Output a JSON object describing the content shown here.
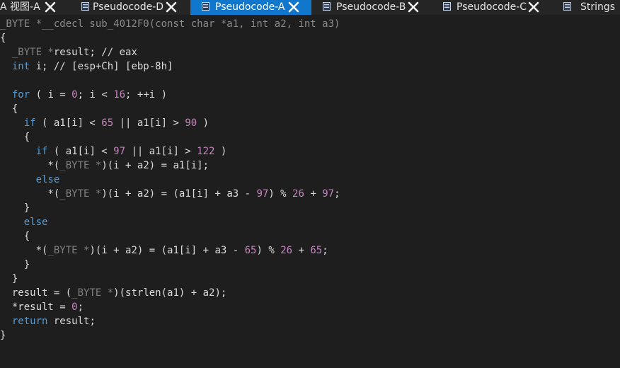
{
  "tabs": [
    {
      "label": "A 视图-A",
      "icon": "",
      "active": false,
      "closable": true
    },
    {
      "label": "Pseudocode-D",
      "icon": "pseudocode-icon",
      "active": false,
      "closable": true
    },
    {
      "label": "Pseudocode-A",
      "icon": "pseudocode-icon",
      "active": true,
      "closable": true
    },
    {
      "label": "Pseudocode-B",
      "icon": "pseudocode-icon",
      "active": false,
      "closable": true
    },
    {
      "label": "Pseudocode-C",
      "icon": "pseudocode-icon",
      "active": false,
      "closable": true
    },
    {
      "label": "Strings",
      "icon": "strings-icon",
      "active": false,
      "closable": false
    }
  ],
  "colors": {
    "background": "#1e1e1e",
    "tabbar": "#252526",
    "active_tab": "#1177cc",
    "keyword": "#569cd6",
    "number": "#c586c0",
    "type": "#7f7f7f",
    "text": "#dcdcdc"
  },
  "code": {
    "lines": [
      [
        [
          "h",
          "_BYTE *__cdecl sub_4012F0(const char *a1, int a2, int a3)"
        ]
      ],
      [
        [
          "p",
          "{"
        ]
      ],
      [
        [
          "p",
          "  "
        ],
        [
          "t",
          "_BYTE *"
        ],
        [
          "p",
          "result; // eax"
        ]
      ],
      [
        [
          "p",
          "  "
        ],
        [
          "k",
          "int"
        ],
        [
          "p",
          " i; // [esp+Ch] [ebp-8h]"
        ]
      ],
      [],
      [
        [
          "p",
          "  "
        ],
        [
          "k",
          "for"
        ],
        [
          "p",
          " ( i = "
        ],
        [
          "n",
          "0"
        ],
        [
          "p",
          "; i < "
        ],
        [
          "n",
          "16"
        ],
        [
          "p",
          "; ++i )"
        ]
      ],
      [
        [
          "p",
          "  {"
        ]
      ],
      [
        [
          "p",
          "    "
        ],
        [
          "k",
          "if"
        ],
        [
          "p",
          " ( a1[i] < "
        ],
        [
          "n",
          "65"
        ],
        [
          "p",
          " || a1[i] > "
        ],
        [
          "n",
          "90"
        ],
        [
          "p",
          " )"
        ]
      ],
      [
        [
          "p",
          "    {"
        ]
      ],
      [
        [
          "p",
          "      "
        ],
        [
          "k",
          "if"
        ],
        [
          "p",
          " ( a1[i] < "
        ],
        [
          "n",
          "97"
        ],
        [
          "p",
          " || a1[i] > "
        ],
        [
          "n",
          "122"
        ],
        [
          "p",
          " )"
        ]
      ],
      [
        [
          "p",
          "        *("
        ],
        [
          "t",
          "_BYTE *"
        ],
        [
          "p",
          ")(i + a2) = a1[i];"
        ]
      ],
      [
        [
          "p",
          "      "
        ],
        [
          "k",
          "else"
        ]
      ],
      [
        [
          "p",
          "        *("
        ],
        [
          "t",
          "_BYTE *"
        ],
        [
          "p",
          ")(i + a2) = (a1[i] + a3 - "
        ],
        [
          "n",
          "97"
        ],
        [
          "p",
          ") % "
        ],
        [
          "n",
          "26"
        ],
        [
          "p",
          " + "
        ],
        [
          "n",
          "97"
        ],
        [
          "p",
          ";"
        ]
      ],
      [
        [
          "p",
          "    }"
        ]
      ],
      [
        [
          "p",
          "    "
        ],
        [
          "k",
          "else"
        ]
      ],
      [
        [
          "p",
          "    {"
        ]
      ],
      [
        [
          "p",
          "      *("
        ],
        [
          "t",
          "_BYTE *"
        ],
        [
          "p",
          ")(i + a2) = (a1[i] + a3 - "
        ],
        [
          "n",
          "65"
        ],
        [
          "p",
          ") % "
        ],
        [
          "n",
          "26"
        ],
        [
          "p",
          " + "
        ],
        [
          "n",
          "65"
        ],
        [
          "p",
          ";"
        ]
      ],
      [
        [
          "p",
          "    }"
        ]
      ],
      [
        [
          "p",
          "  }"
        ]
      ],
      [
        [
          "p",
          "  result = ("
        ],
        [
          "t",
          "_BYTE *"
        ],
        [
          "p",
          ")("
        ],
        [
          "f",
          "strlen"
        ],
        [
          "p",
          "(a1) + a2);"
        ]
      ],
      [
        [
          "p",
          "  *result = "
        ],
        [
          "n",
          "0"
        ],
        [
          "p",
          ";"
        ]
      ],
      [
        [
          "p",
          "  "
        ],
        [
          "k",
          "return"
        ],
        [
          "p",
          " result;"
        ]
      ],
      [
        [
          "p",
          "}"
        ]
      ]
    ]
  }
}
